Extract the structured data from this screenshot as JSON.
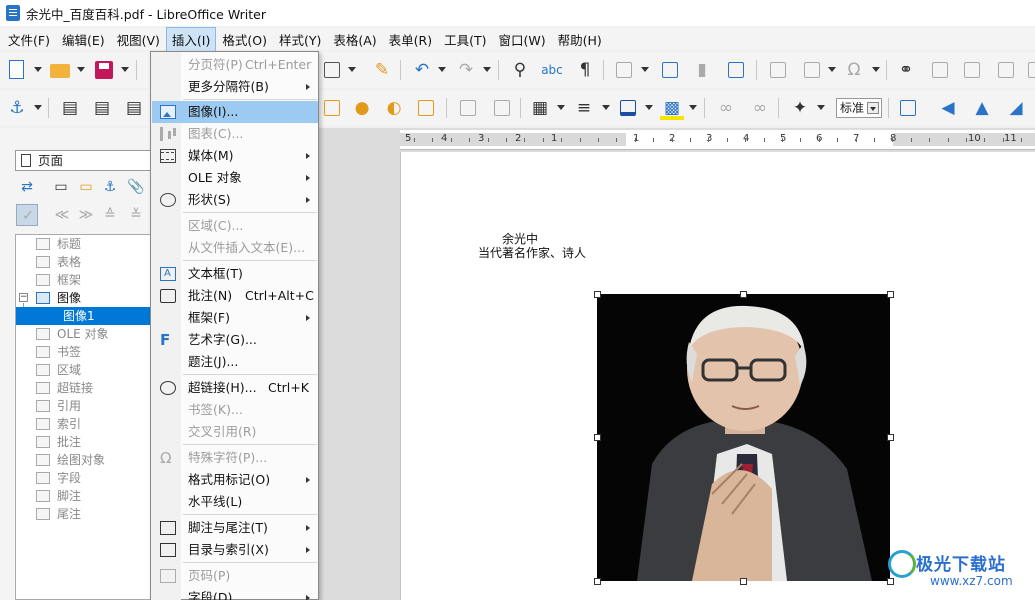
{
  "window": {
    "title": "余光中_百度百科.pdf - LibreOffice Writer"
  },
  "menubar": {
    "items": [
      {
        "label": "文件(F)"
      },
      {
        "label": "编辑(E)"
      },
      {
        "label": "视图(V)"
      },
      {
        "label": "插入(I)"
      },
      {
        "label": "格式(O)"
      },
      {
        "label": "样式(Y)"
      },
      {
        "label": "表格(A)"
      },
      {
        "label": "表单(R)"
      },
      {
        "label": "工具(T)"
      },
      {
        "label": "窗口(W)"
      },
      {
        "label": "帮助(H)"
      }
    ],
    "active_index": 3
  },
  "toolbar": {
    "paragraph_style": "标准"
  },
  "navigator": {
    "selector": "页面",
    "tree": [
      {
        "label": "标题"
      },
      {
        "label": "表格"
      },
      {
        "label": "框架"
      },
      {
        "label": "图像"
      },
      {
        "label": "图像1"
      },
      {
        "label": "OLE 对象"
      },
      {
        "label": "书签"
      },
      {
        "label": "区域"
      },
      {
        "label": "超链接"
      },
      {
        "label": "引用"
      },
      {
        "label": "索引"
      },
      {
        "label": "批注"
      },
      {
        "label": "绘图对象"
      },
      {
        "label": "字段"
      },
      {
        "label": "脚注"
      },
      {
        "label": "尾注"
      }
    ]
  },
  "ruler": {
    "labels": [
      "5",
      "4",
      "3",
      "2",
      "1",
      "1",
      "2",
      "3",
      "4",
      "5",
      "6",
      "7",
      "8",
      "10",
      "11"
    ]
  },
  "document": {
    "name": "余光中",
    "subtitle": "当代著名作家、诗人"
  },
  "insert_menu": {
    "items": [
      {
        "label": "分页符(P)",
        "shortcut": "Ctrl+Enter"
      },
      {
        "label": "更多分隔符(B)"
      },
      {
        "label": "图像(I)..."
      },
      {
        "label": "图表(C)..."
      },
      {
        "label": "媒体(M)"
      },
      {
        "label": "OLE 对象"
      },
      {
        "label": "形状(S)"
      },
      {
        "label": "区域(C)..."
      },
      {
        "label": "从文件插入文本(E)..."
      },
      {
        "label": "文本框(T)"
      },
      {
        "label": "批注(N)",
        "shortcut": "Ctrl+Alt+C"
      },
      {
        "label": "框架(F)"
      },
      {
        "label": "艺术字(G)..."
      },
      {
        "label": "题注(J)..."
      },
      {
        "label": "超链接(H)...",
        "shortcut": "Ctrl+K"
      },
      {
        "label": "书签(K)..."
      },
      {
        "label": "交叉引用(R)"
      },
      {
        "label": "特殊字符(P)..."
      },
      {
        "label": "格式用标记(O)"
      },
      {
        "label": "水平线(L)"
      },
      {
        "label": "脚注与尾注(T)"
      },
      {
        "label": "目录与索引(X)"
      },
      {
        "label": "页码(P)"
      },
      {
        "label": "字段(D)"
      }
    ]
  },
  "watermark": {
    "brand": "极光下载站",
    "url": "www.xz7.com"
  }
}
